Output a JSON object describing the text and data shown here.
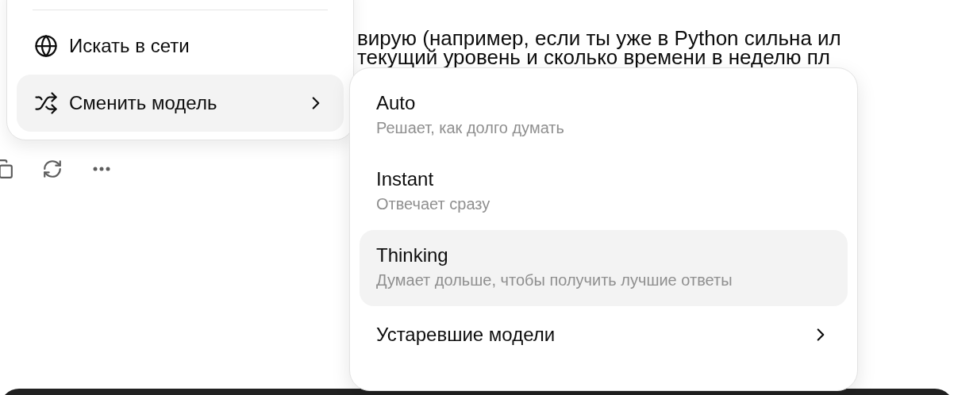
{
  "message": {
    "lines": [
      "вирую (например, если ты уже в Python сильна ил",
      "текущий уровень и сколько времени в неделю пл"
    ]
  },
  "actions": [
    {
      "kind": "copy"
    },
    {
      "kind": "regenerate"
    },
    {
      "kind": "more"
    }
  ],
  "menu": {
    "items": [
      {
        "kind": "web_search",
        "label": "Искать в сети",
        "highlighted": false
      },
      {
        "kind": "model_switch",
        "label": "Сменить модель",
        "highlighted": true
      }
    ]
  },
  "model_menu": {
    "items": [
      {
        "kind": "option",
        "title": "Auto",
        "description": "Решает, как долго думать",
        "highlighted": false
      },
      {
        "kind": "option",
        "title": "Instant",
        "description": "Отвечает сразу",
        "highlighted": false
      },
      {
        "kind": "option",
        "title": "Thinking",
        "description": "Думает дольше, чтобы получить лучшие ответы",
        "highlighted": true
      },
      {
        "kind": "submenu",
        "title": "Устаревшие модели",
        "highlighted": false
      }
    ]
  }
}
